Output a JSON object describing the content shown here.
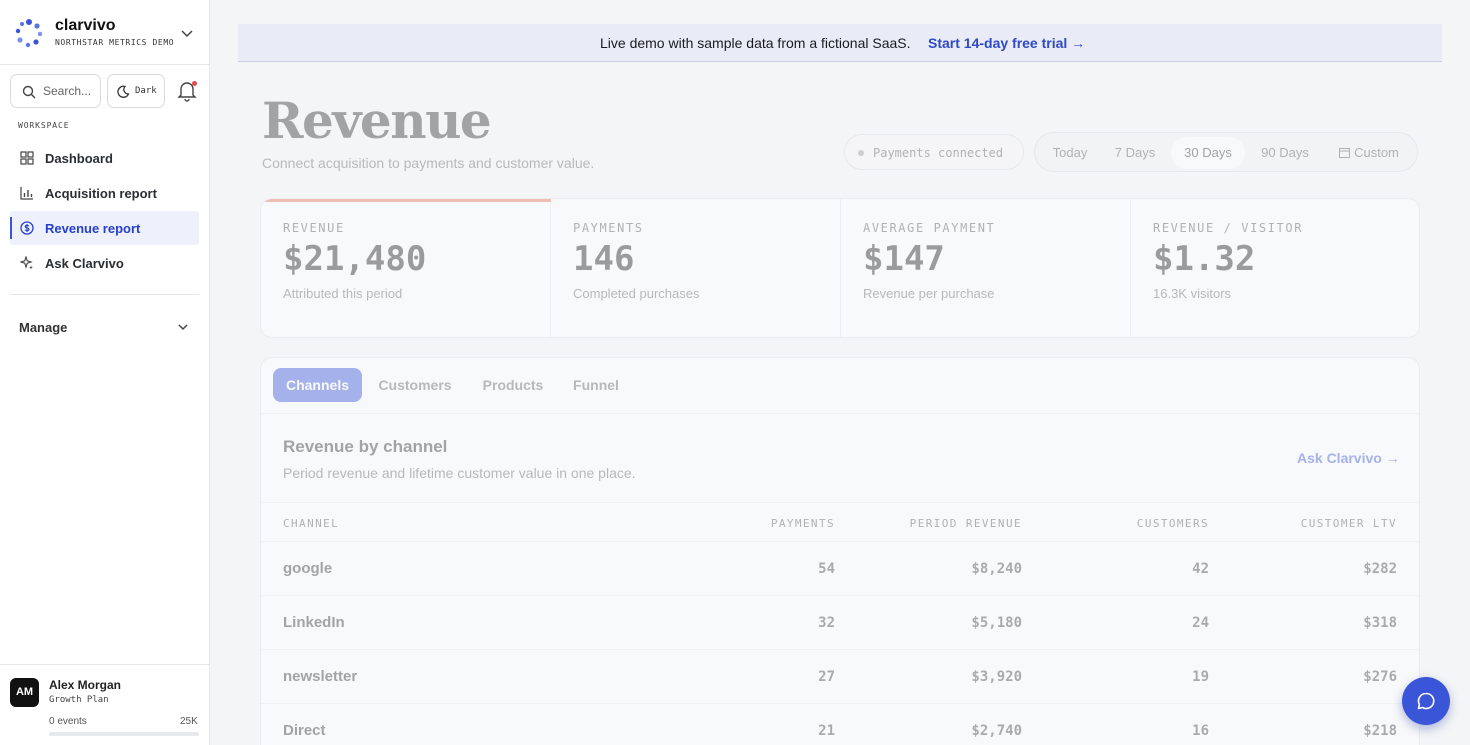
{
  "brand": {
    "name": "clarvivo",
    "subtitle": "NORTHSTAR METRICS DEMO"
  },
  "sidebar": {
    "search_placeholder": "Search...",
    "theme_toggle": "Dark",
    "section_label": "WORKSPACE",
    "items": [
      {
        "label": "Dashboard",
        "icon": "grid-icon"
      },
      {
        "label": "Acquisition report",
        "icon": "bar-chart-icon"
      },
      {
        "label": "Revenue report",
        "icon": "dollar-circle-icon",
        "active": true
      },
      {
        "label": "Ask Clarvivo",
        "icon": "sparkle-icon"
      }
    ],
    "manage_label": "Manage"
  },
  "user": {
    "initials": "AM",
    "name": "Alex Morgan",
    "plan": "Growth Plan",
    "events": "0 events",
    "events_limit": "25K",
    "usage_fraction": 0
  },
  "banner": {
    "text": "Live demo with sample data from a fictional SaaS.",
    "link": "Start 14-day free trial →"
  },
  "page": {
    "title": "Revenue",
    "subtitle": "Connect acquisition to payments and customer value.",
    "status": "Payments connected",
    "ranges": [
      "Today",
      "7 Days",
      "30 Days",
      "90 Days",
      "Custom"
    ],
    "active_range": "30 Days"
  },
  "kpis": [
    {
      "label": "REVENUE",
      "value": "$21,480",
      "note": "Attributed this period"
    },
    {
      "label": "PAYMENTS",
      "value": "146",
      "note": "Completed purchases"
    },
    {
      "label": "AVERAGE PAYMENT",
      "value": "$147",
      "note": "Revenue per purchase"
    },
    {
      "label": "REVENUE / VISITOR",
      "value": "$1.32",
      "note": "16.3K visitors"
    }
  ],
  "tabs": [
    "Channels",
    "Customers",
    "Products",
    "Funnel"
  ],
  "active_tab": "Channels",
  "section": {
    "title": "Revenue by channel",
    "subtitle": "Period revenue and lifetime customer value in one place.",
    "ask_link": "Ask Clarvivo →"
  },
  "table": {
    "columns": [
      "CHANNEL",
      "PAYMENTS",
      "PERIOD REVENUE",
      "CUSTOMERS",
      "CUSTOMER LTV"
    ],
    "rows": [
      [
        "google",
        "54",
        "$8,240",
        "42",
        "$282"
      ],
      [
        "LinkedIn",
        "32",
        "$5,180",
        "24",
        "$318"
      ],
      [
        "newsletter",
        "27",
        "$3,920",
        "19",
        "$276"
      ],
      [
        "Direct",
        "21",
        "$2,740",
        "16",
        "$218"
      ]
    ]
  },
  "colors": {
    "accent": "#3b55d9",
    "kpi_highlight": "#e8734f",
    "alert_dot": "#e5484d"
  }
}
